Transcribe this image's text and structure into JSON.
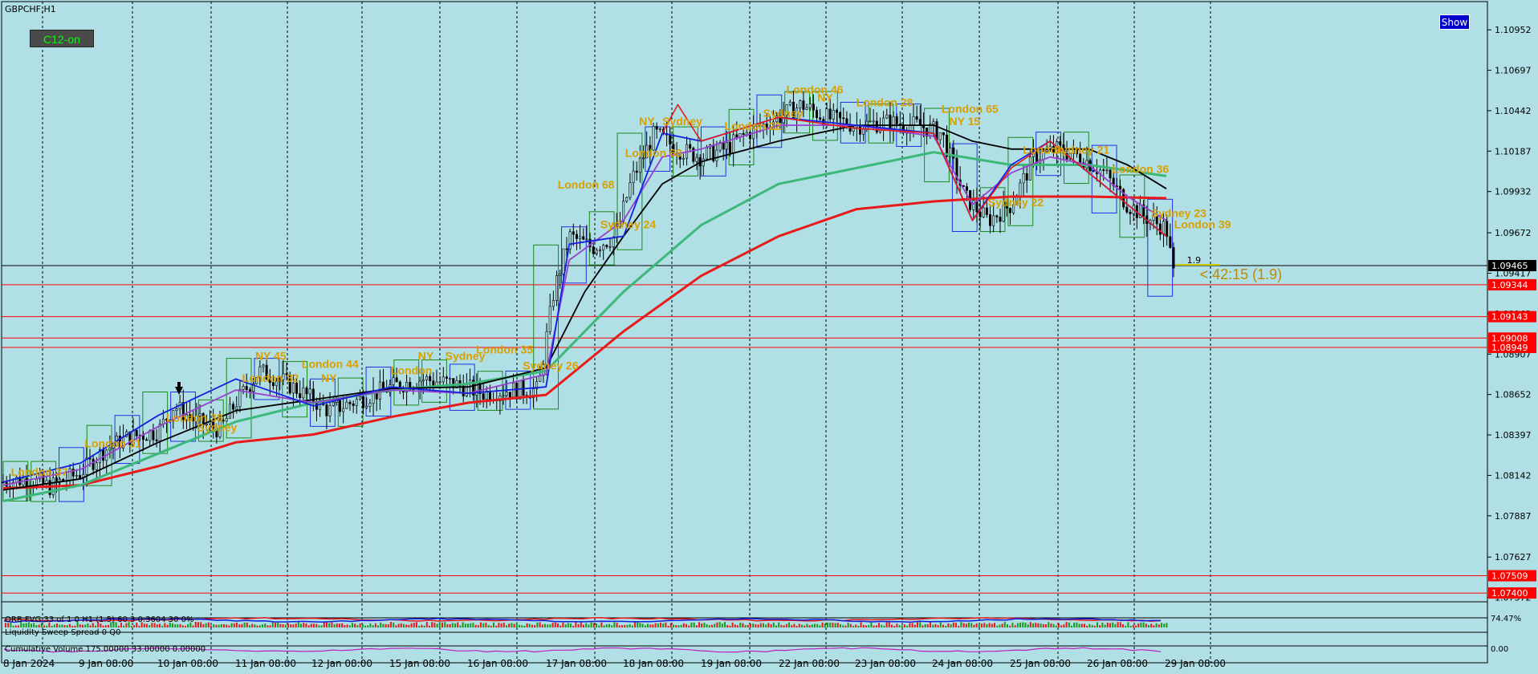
{
  "chart_window": {
    "title": "GBPCHF,H1",
    "show_button": "Show",
    "badge": "C12-on"
  },
  "chart_data": {
    "type": "candlestick",
    "symbol": "GBPCHF",
    "timeframe": "H1",
    "price_ticks": [
      "1.10952",
      "1.10697",
      "1.10442",
      "1.10187",
      "1.09932",
      "1.09672",
      "1.09417",
      "1.09162",
      "1.08907",
      "1.08652",
      "1.08397",
      "1.08142",
      "1.07887",
      "1.07627",
      "1.07372"
    ],
    "ylim": [
      1.0737,
      1.1114
    ],
    "x_labels": [
      "8 Jan 2024",
      "9 Jan 08:00",
      "10 Jan 08:00",
      "11 Jan 08:00",
      "12 Jan 08:00",
      "15 Jan 08:00",
      "16 Jan 08:00",
      "17 Jan 08:00",
      "18 Jan 08:00",
      "19 Jan 08:00",
      "22 Jan 08:00",
      "23 Jan 08:00",
      "24 Jan 08:00",
      "25 Jan 08:00",
      "26 Jan 08:00",
      "29 Jan 08:00"
    ],
    "close_path": [
      {
        "t": 0.0,
        "p": 1.081
      },
      {
        "t": 0.3,
        "p": 1.0812
      },
      {
        "t": 0.6,
        "p": 1.0807
      },
      {
        "t": 1.0,
        "p": 1.0816
      },
      {
        "t": 1.3,
        "p": 1.083
      },
      {
        "t": 1.6,
        "p": 1.0838
      },
      {
        "t": 2.0,
        "p": 1.0842
      },
      {
        "t": 2.2,
        "p": 1.0858
      },
      {
        "t": 2.5,
        "p": 1.0848
      },
      {
        "t": 2.8,
        "p": 1.0843
      },
      {
        "t": 3.0,
        "p": 1.086
      },
      {
        "t": 3.3,
        "p": 1.088
      },
      {
        "t": 3.6,
        "p": 1.0874
      },
      {
        "t": 3.9,
        "p": 1.0865
      },
      {
        "t": 4.2,
        "p": 1.0855
      },
      {
        "t": 4.6,
        "p": 1.0862
      },
      {
        "t": 5.0,
        "p": 1.087
      },
      {
        "t": 5.4,
        "p": 1.0875
      },
      {
        "t": 5.8,
        "p": 1.0872
      },
      {
        "t": 6.2,
        "p": 1.0866
      },
      {
        "t": 6.5,
        "p": 1.0868
      },
      {
        "t": 6.9,
        "p": 1.0868
      },
      {
        "t": 7.1,
        "p": 1.093
      },
      {
        "t": 7.3,
        "p": 1.0965
      },
      {
        "t": 7.6,
        "p": 1.0958
      },
      {
        "t": 7.9,
        "p": 1.0965
      },
      {
        "t": 8.1,
        "p": 1.1
      },
      {
        "t": 8.4,
        "p": 1.103
      },
      {
        "t": 8.7,
        "p": 1.102
      },
      {
        "t": 9.0,
        "p": 1.1015
      },
      {
        "t": 9.3,
        "p": 1.102
      },
      {
        "t": 9.6,
        "p": 1.103
      },
      {
        "t": 10.0,
        "p": 1.104
      },
      {
        "t": 10.3,
        "p": 1.1048
      },
      {
        "t": 10.6,
        "p": 1.104
      },
      {
        "t": 11.0,
        "p": 1.1035
      },
      {
        "t": 11.4,
        "p": 1.1037
      },
      {
        "t": 11.8,
        "p": 1.1035
      },
      {
        "t": 12.1,
        "p": 1.103
      },
      {
        "t": 12.4,
        "p": 1.099
      },
      {
        "t": 12.7,
        "p": 1.0975
      },
      {
        "t": 13.0,
        "p": 1.0985
      },
      {
        "t": 13.3,
        "p": 1.1015
      },
      {
        "t": 13.6,
        "p": 1.102
      },
      {
        "t": 13.9,
        "p": 1.1015
      },
      {
        "t": 14.2,
        "p": 1.1005
      },
      {
        "t": 14.5,
        "p": 1.0985
      },
      {
        "t": 14.8,
        "p": 1.0975
      },
      {
        "t": 15.0,
        "p": 1.097
      },
      {
        "t": 15.12,
        "p": 1.0933
      }
    ],
    "moving_averages": [
      {
        "color": "#e81a1a",
        "width": 3,
        "points": [
          [
            0.0,
            1.0806
          ],
          [
            1.0,
            1.0808
          ],
          [
            2.0,
            1.082
          ],
          [
            3.0,
            1.0835
          ],
          [
            4.0,
            1.084
          ],
          [
            5.0,
            1.0851
          ],
          [
            6.0,
            1.086
          ],
          [
            7.0,
            1.0865
          ],
          [
            8.0,
            1.0905
          ],
          [
            9.0,
            1.094
          ],
          [
            10.0,
            1.0965
          ],
          [
            11.0,
            1.0982
          ],
          [
            12.0,
            1.0987
          ],
          [
            13.0,
            1.099
          ],
          [
            14.0,
            1.099
          ],
          [
            15.0,
            1.0989
          ]
        ]
      },
      {
        "color": "#3cb878",
        "width": 3,
        "points": [
          [
            0.0,
            1.0798
          ],
          [
            1.0,
            1.0808
          ],
          [
            2.0,
            1.0828
          ],
          [
            3.0,
            1.0848
          ],
          [
            4.0,
            1.086
          ],
          [
            5.0,
            1.0868
          ],
          [
            6.0,
            1.0872
          ],
          [
            7.0,
            1.088
          ],
          [
            8.0,
            1.093
          ],
          [
            9.0,
            1.0972
          ],
          [
            10.0,
            1.0998
          ],
          [
            11.0,
            1.1008
          ],
          [
            12.0,
            1.1018
          ],
          [
            13.0,
            1.101
          ],
          [
            14.0,
            1.101
          ],
          [
            15.0,
            1.1003
          ]
        ]
      },
      {
        "color": "#000000",
        "width": 1.8,
        "points": [
          [
            0.0,
            1.0805
          ],
          [
            1.0,
            1.0812
          ],
          [
            2.0,
            1.0835
          ],
          [
            3.0,
            1.0855
          ],
          [
            4.0,
            1.0862
          ],
          [
            5.0,
            1.0869
          ],
          [
            6.0,
            1.087
          ],
          [
            7.0,
            1.0882
          ],
          [
            7.5,
            1.093
          ],
          [
            8.0,
            1.0965
          ],
          [
            8.5,
            1.0998
          ],
          [
            9.0,
            1.1012
          ],
          [
            10.0,
            1.1025
          ],
          [
            11.0,
            1.1035
          ],
          [
            12.0,
            1.1035
          ],
          [
            12.5,
            1.1025
          ],
          [
            13.0,
            1.102
          ],
          [
            13.5,
            1.102
          ],
          [
            14.0,
            1.102
          ],
          [
            14.5,
            1.101
          ],
          [
            15.0,
            1.0995
          ]
        ]
      },
      {
        "color": "#9a3fd0",
        "width": 1.8,
        "points": [
          [
            0.0,
            1.0808
          ],
          [
            1.0,
            1.0818
          ],
          [
            2.0,
            1.0845
          ],
          [
            3.0,
            1.0868
          ],
          [
            4.0,
            1.086
          ],
          [
            5.0,
            1.0868
          ],
          [
            6.0,
            1.0866
          ],
          [
            7.0,
            1.0878
          ],
          [
            7.3,
            1.095
          ],
          [
            8.0,
            1.0975
          ],
          [
            8.5,
            1.1015
          ],
          [
            9.0,
            1.102
          ],
          [
            10.0,
            1.1035
          ],
          [
            11.0,
            1.1035
          ],
          [
            12.0,
            1.1028
          ],
          [
            12.5,
            1.0985
          ],
          [
            13.0,
            1.1005
          ],
          [
            13.5,
            1.1015
          ],
          [
            14.0,
            1.101
          ],
          [
            14.5,
            1.099
          ],
          [
            15.0,
            1.0975
          ]
        ]
      },
      {
        "color": "#1420e0",
        "width": 1.8,
        "points": [
          [
            0.0,
            1.081
          ],
          [
            1.0,
            1.0822
          ],
          [
            2.0,
            1.0852
          ],
          [
            3.0,
            1.0875
          ],
          [
            4.0,
            1.0858
          ],
          [
            5.0,
            1.087
          ],
          [
            6.0,
            1.0866
          ],
          [
            7.0,
            1.087
          ],
          [
            7.3,
            1.096
          ],
          [
            8.0,
            1.0965
          ],
          [
            8.5,
            1.103
          ],
          [
            9.0,
            1.1025
          ],
          [
            10.0,
            1.104
          ],
          [
            11.0,
            1.1035
          ],
          [
            12.0,
            1.103
          ],
          [
            12.5,
            1.0975
          ],
          [
            13.0,
            1.101
          ],
          [
            13.5,
            1.1025
          ],
          [
            14.0,
            1.1005
          ],
          [
            14.5,
            1.0985
          ],
          [
            15.0,
            1.0965
          ]
        ]
      },
      {
        "color": "#e81a1a",
        "width": 1.6,
        "points": [
          [
            8.5,
            1.103
          ],
          [
            8.7,
            1.1048
          ],
          [
            9.0,
            1.1025
          ],
          [
            10.0,
            1.104
          ],
          [
            11.0,
            1.1033
          ],
          [
            12.0,
            1.103
          ],
          [
            12.5,
            1.0975
          ],
          [
            13.0,
            1.1008
          ],
          [
            13.5,
            1.1025
          ],
          [
            14.0,
            1.1005
          ],
          [
            14.5,
            1.0985
          ],
          [
            15.0,
            1.0965
          ]
        ]
      }
    ],
    "horizontal_lines": [
      {
        "price": 1.09465,
        "color": "#000000",
        "tag": "1.09465",
        "tag_bg": "#000000",
        "tag_fg": "#ffffff"
      },
      {
        "price": 1.09344,
        "color": "#ff0000",
        "tag": "1.09344",
        "tag_bg": "#ff0000",
        "tag_fg": "#ffffff"
      },
      {
        "price": 1.09143,
        "color": "#ff0000",
        "tag": "1.09143",
        "tag_bg": "#ff0000",
        "tag_fg": "#ffffff"
      },
      {
        "price": 1.09008,
        "color": "#ff0000",
        "tag": "1.09008",
        "tag_bg": "#ff0000",
        "tag_fg": "#ffffff"
      },
      {
        "price": 1.08949,
        "color": "#ff0000",
        "tag": "1.08949",
        "tag_bg": "#ff0000",
        "tag_fg": "#ffffff"
      },
      {
        "price": 1.07509,
        "color": "#ff0000",
        "tag": "1.07509",
        "tag_bg": "#ff0000",
        "tag_fg": "#ffffff"
      },
      {
        "price": 1.074,
        "color": "#ff0000",
        "tag": "1.07400",
        "tag_bg": "#ff0000",
        "tag_fg": "#ffffff"
      }
    ],
    "session_labels": [
      {
        "t": 0.1,
        "p": 1.0814,
        "text": "London 37"
      },
      {
        "t": 1.05,
        "p": 1.0832,
        "text": "London 31"
      },
      {
        "t": 2.1,
        "p": 1.0848,
        "text": "London 38"
      },
      {
        "t": 2.5,
        "p": 1.0842,
        "text": "Sydney"
      },
      {
        "t": 3.08,
        "p": 1.0873,
        "text": "London 32"
      },
      {
        "t": 3.25,
        "p": 1.0887,
        "text": "NY 45"
      },
      {
        "t": 3.85,
        "p": 1.0882,
        "text": "London 44"
      },
      {
        "t": 4.1,
        "p": 1.0873,
        "text": "NY"
      },
      {
        "t": 5.0,
        "p": 1.0878,
        "text": "London"
      },
      {
        "t": 5.35,
        "p": 1.0887,
        "text": "NY"
      },
      {
        "t": 5.7,
        "p": 1.0887,
        "text": "Sydney"
      },
      {
        "t": 6.1,
        "p": 1.0891,
        "text": "London 35"
      },
      {
        "t": 6.7,
        "p": 1.0881,
        "text": "Sydney 26"
      },
      {
        "t": 7.15,
        "p": 1.0995,
        "text": "London 68"
      },
      {
        "t": 7.7,
        "p": 1.097,
        "text": "Sydney 24"
      },
      {
        "t": 8.02,
        "p": 1.1015,
        "text": "London 68"
      },
      {
        "t": 8.2,
        "p": 1.1035,
        "text": "NY"
      },
      {
        "t": 8.5,
        "p": 1.1035,
        "text": "Sydney"
      },
      {
        "t": 9.3,
        "p": 1.1032,
        "text": "London 22"
      },
      {
        "t": 9.8,
        "p": 1.104,
        "text": "Sydney"
      },
      {
        "t": 10.1,
        "p": 1.1055,
        "text": "London 46"
      },
      {
        "t": 10.5,
        "p": 1.105,
        "text": "NY"
      },
      {
        "t": 11.0,
        "p": 1.1047,
        "text": "London 28"
      },
      {
        "t": 12.1,
        "p": 1.1043,
        "text": "London 65"
      },
      {
        "t": 12.2,
        "p": 1.1035,
        "text": "NY 15"
      },
      {
        "t": 12.7,
        "p": 1.0984,
        "text": "Sydney 22"
      },
      {
        "t": 13.15,
        "p": 1.1017,
        "text": "London"
      },
      {
        "t": 13.55,
        "p": 1.1017,
        "text": "Sydney 21"
      },
      {
        "t": 14.3,
        "p": 1.1005,
        "text": "London 36"
      },
      {
        "t": 14.8,
        "p": 1.0977,
        "text": "Sydney 23"
      },
      {
        "t": 15.1,
        "p": 1.097,
        "text": "London 39"
      }
    ],
    "countdown_label": "< 42:15 (1.9)",
    "small_label": "1.9"
  },
  "indicators": {
    "row1_text": "ORB FVG 33 of 1 0 H1 (1.5) 60 3 0.3604 30 0%",
    "row2_text": "Liquidity Sweep Spread 0 Q0",
    "row3_text": "Cumulative Volume 175.00000 33.00000 0.00000",
    "row3_right": "0.00",
    "row1_right": "74.47%"
  }
}
